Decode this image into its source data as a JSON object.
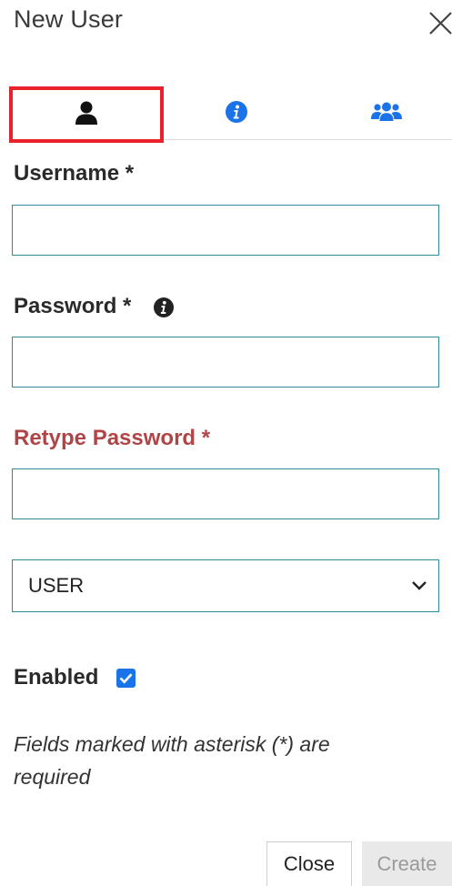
{
  "dialog": {
    "title": "New User",
    "close_icon": "close-x-icon"
  },
  "tabs": [
    {
      "icon": "user-icon",
      "selected": true
    },
    {
      "icon": "info-circle-icon",
      "selected": false
    },
    {
      "icon": "users-group-icon",
      "selected": false
    }
  ],
  "form": {
    "username": {
      "label": "Username *",
      "value": ""
    },
    "password": {
      "label": "Password *",
      "value": "",
      "info_icon": "info-circle-icon"
    },
    "retype_password": {
      "label": "Retype Password *",
      "value": ""
    },
    "role": {
      "value": "USER"
    },
    "enabled": {
      "label": "Enabled",
      "checked": true
    },
    "note": "Fields marked with asterisk (*) are required"
  },
  "footer": {
    "close_label": "Close",
    "create_label": "Create"
  },
  "colors": {
    "accent_border": "#2c8c97",
    "icon_blue": "#1a73e8",
    "error_red": "#b04547",
    "selection_highlight": "#e8212a"
  }
}
